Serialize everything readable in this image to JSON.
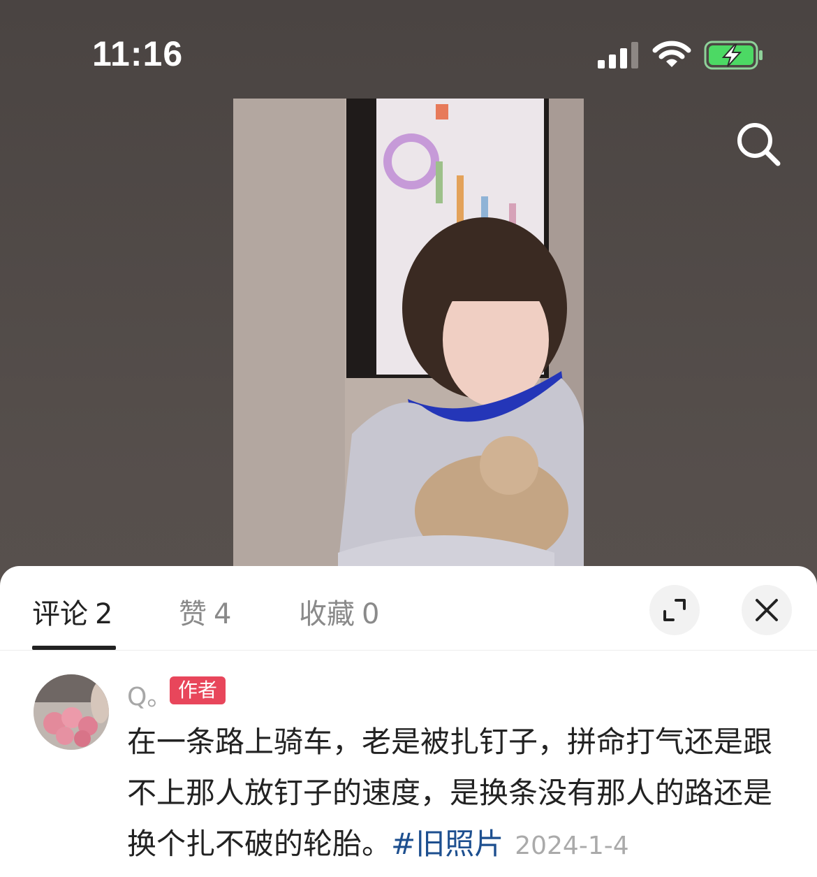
{
  "status_bar": {
    "time": "11:16"
  },
  "icons": {
    "signal": "cellular-signal-icon",
    "wifi": "wifi-icon",
    "battery": "battery-charging-icon",
    "search": "search-icon",
    "expand": "expand-icon",
    "close": "close-icon"
  },
  "colors": {
    "battery_fill": "#4cd964",
    "author_badge": "#e8465b",
    "hashtag": "#1d4f8f",
    "active_tab": "#222222",
    "inactive_tab": "#8a8a8a"
  },
  "tabs": [
    {
      "label": "评论",
      "count": "2",
      "active": true
    },
    {
      "label": "赞",
      "count": "4",
      "active": false
    },
    {
      "label": "收藏",
      "count": "0",
      "active": false
    }
  ],
  "comment": {
    "username": "Q。",
    "badge": "作者",
    "text": "在一条路上骑车，老是被扎钉子，拼命打气还是跟不上那人放钉子的速度，是换条没有那人的路还是换个扎不破的轮胎。",
    "hashtag": "#旧照片",
    "date": "2024-1-4"
  }
}
